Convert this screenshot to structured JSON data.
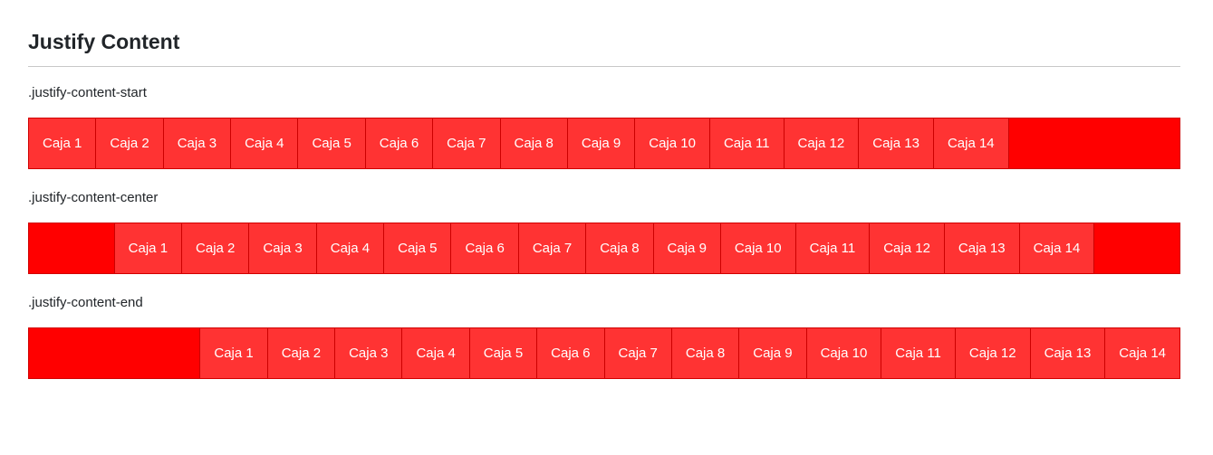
{
  "page": {
    "title": "Justify Content"
  },
  "sections": [
    {
      "label": ".justify-content-start",
      "mode": "start"
    },
    {
      "label": ".justify-content-center",
      "mode": "center"
    },
    {
      "label": ".justify-content-end",
      "mode": "end"
    }
  ],
  "boxes": [
    "Caja 1",
    "Caja 2",
    "Caja 3",
    "Caja 4",
    "Caja 5",
    "Caja 6",
    "Caja 7",
    "Caja 8",
    "Caja 9",
    "Caja 10",
    "Caja 11",
    "Caja 12",
    "Caja 13",
    "Caja 14"
  ],
  "colors": {
    "container": "#ff0000",
    "box": "#ff3333",
    "text": "#ffffff"
  }
}
